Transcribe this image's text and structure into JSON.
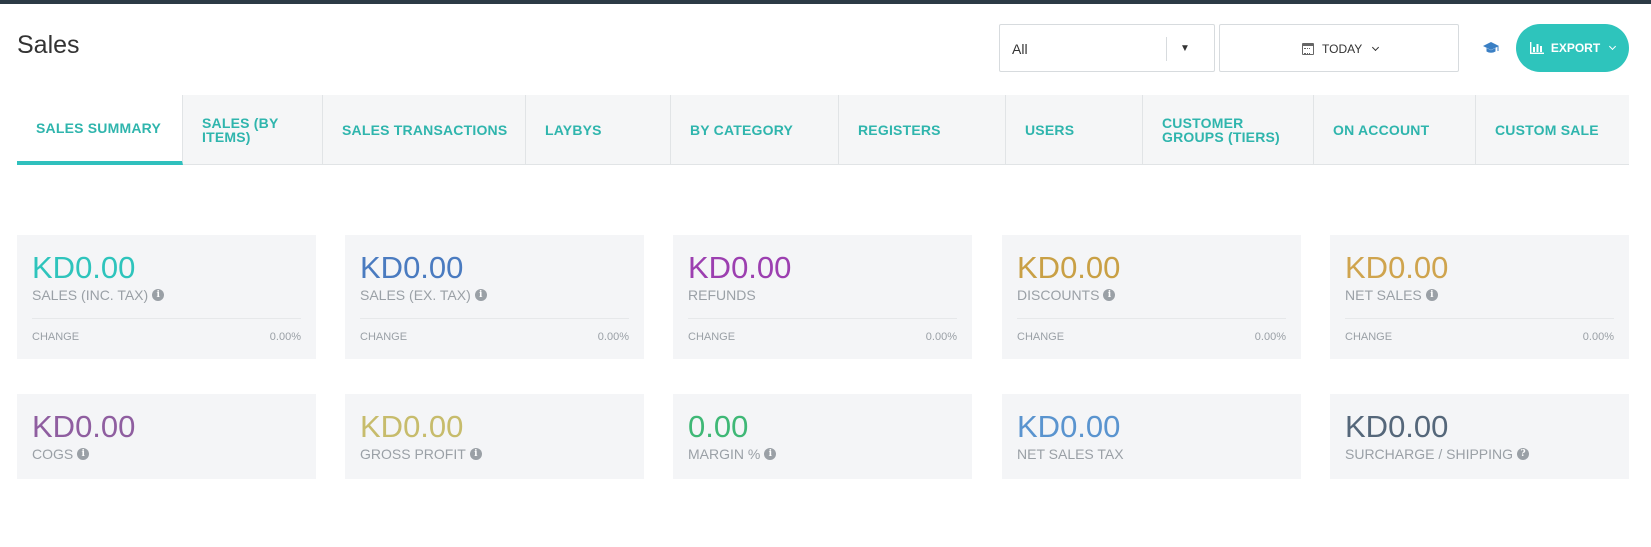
{
  "page": {
    "title": "Sales"
  },
  "filters": {
    "outlet_select_value": "All",
    "date_range_label": "TODAY"
  },
  "toolbar": {
    "export_label": "EXPORT"
  },
  "tabs": [
    {
      "label": "SALES SUMMARY",
      "active": true
    },
    {
      "label": "SALES (BY ITEMS)"
    },
    {
      "label": "SALES TRANSACTIONS"
    },
    {
      "label": "LAYBYS"
    },
    {
      "label": "BY CATEGORY"
    },
    {
      "label": "REGISTERS"
    },
    {
      "label": "USERS"
    },
    {
      "label": "CUSTOMER GROUPS (TIERS)"
    },
    {
      "label": "ON ACCOUNT"
    },
    {
      "label": "CUSTOM SALE"
    }
  ],
  "summary_cards": [
    {
      "amount": "KD0.00",
      "label": "SALES (INC. TAX)",
      "info": true,
      "change_label": "CHANGE",
      "change_value": "0.00%",
      "color": "#2ec4bc"
    },
    {
      "amount": "KD0.00",
      "label": "SALES (EX. TAX)",
      "info": true,
      "change_label": "CHANGE",
      "change_value": "0.00%",
      "color": "#4a7bc0"
    },
    {
      "amount": "KD0.00",
      "label": "REFUNDS",
      "info": false,
      "change_label": "CHANGE",
      "change_value": "0.00%",
      "color": "#9c3fb0"
    },
    {
      "amount": "KD0.00",
      "label": "DISCOUNTS",
      "info": true,
      "change_label": "CHANGE",
      "change_value": "0.00%",
      "color": "#c9a045"
    },
    {
      "amount": "KD0.00",
      "label": "NET SALES",
      "info": true,
      "change_label": "CHANGE",
      "change_value": "0.00%",
      "color": "#cfa44e"
    }
  ],
  "metric_cards": [
    {
      "amount": "KD0.00",
      "label": "COGS",
      "info": "i",
      "color": "#8f5ea0"
    },
    {
      "amount": "KD0.00",
      "label": "GROSS PROFIT",
      "info": "i",
      "color": "#c7bc6c"
    },
    {
      "amount": "0.00",
      "label": "MARGIN %",
      "info": "i",
      "color": "#3fb876"
    },
    {
      "amount": "KD0.00",
      "label": "NET SALES TAX",
      "info": "",
      "color": "#5a94cf"
    },
    {
      "amount": "KD0.00",
      "label": "SURCHARGE / SHIPPING",
      "info": "?",
      "color": "#55677a"
    }
  ]
}
